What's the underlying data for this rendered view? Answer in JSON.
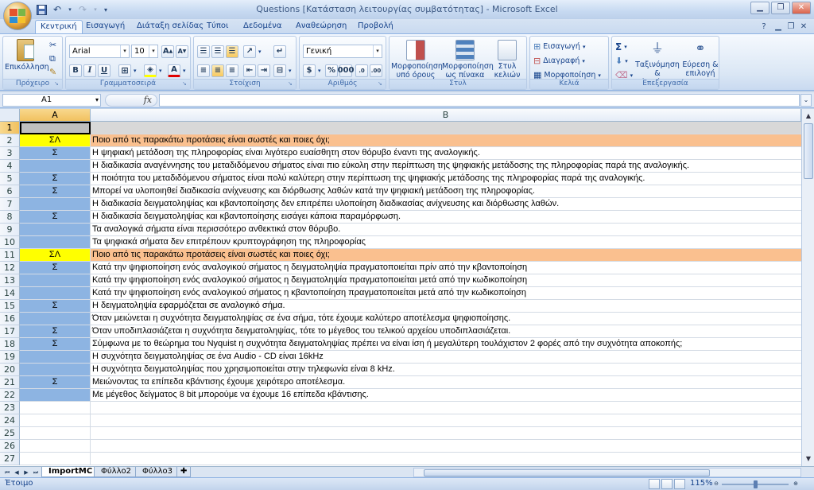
{
  "window": {
    "title": "Questions  [Κατάσταση λειτουργίας συμβατότητας] - Microsoft Excel"
  },
  "tabs": [
    "Κεντρική",
    "Εισαγωγή",
    "Διάταξη σελίδας",
    "Τύποι",
    "Δεδομένα",
    "Αναθεώρηση",
    "Προβολή"
  ],
  "ribbon": {
    "clipboard": {
      "paste": "Επικόλληση",
      "label": "Πρόχειρο"
    },
    "font": {
      "name": "Arial",
      "size": "10",
      "label": "Γραμματοσειρά"
    },
    "alignment": {
      "label": "Στοίχιση"
    },
    "number": {
      "format": "Γενική",
      "label": "Αριθμός"
    },
    "styles": {
      "conditional": "Μορφοποίηση\nυπό όρους",
      "as_table": "Μορφοποίηση\nως πίνακα",
      "cell_styles": "Στυλ\nκελιών",
      "label": "Στυλ"
    },
    "cells": {
      "insert": "Εισαγωγή",
      "delete": "Διαγραφή",
      "format": "Μορφοποίηση",
      "label": "Κελιά"
    },
    "editing": {
      "sort": "Ταξινόμηση &\nφιλτράρισμα",
      "find": "Εύρεση &\nεπιλογή",
      "label": "Επεξεργασία"
    }
  },
  "formula_bar": {
    "name_box": "A1",
    "fx": "fx",
    "value": ""
  },
  "columns": [
    "A",
    "B"
  ],
  "rows": [
    {
      "n": "1",
      "a": "",
      "b": "",
      "type": "gray"
    },
    {
      "n": "2",
      "a": "ΣΛ",
      "b": "Ποιο από τις παρακάτω προτάσεις είναι σωστές και ποιες όχι;",
      "type": "q"
    },
    {
      "n": "3",
      "a": "Σ",
      "b": "Η ψηφιακή μετάδοση της πληροφορίας είναι λιγότερο ευαίσθητη στον θόρυβο έναντι της αναλογικής.",
      "type": "ans"
    },
    {
      "n": "4",
      "a": "",
      "b": "Η διαδικασία αναγέννησης του μεταδιδόμενου σήματος είναι πιο εύκολη στην περίπτωση της ψηφιακής μετάδοσης της πληροφορίας παρά της αναλογικής.",
      "type": "ans"
    },
    {
      "n": "5",
      "a": "Σ",
      "b": "Η ποιότητα του μεταδιδόμενου σήματος είναι πολύ καλύτερη στην περίπτωση της ψηφιακής μετάδοσης της πληροφορίας παρά της αναλογικής.",
      "type": "ans"
    },
    {
      "n": "6",
      "a": "Σ",
      "b": "Μπορεί να υλοποιηθεί διαδικασία ανίχνευσης και διόρθωσης λαθών κατά την ψηφιακή μετάδοση της πληροφορίας.",
      "type": "ans"
    },
    {
      "n": "7",
      "a": "",
      "b": "Η διαδικασία δειγματοληψίας και κβαντοποίησης δεν επιτρέπει υλοποίηση διαδικασίας ανίχνευσης και διόρθωσης λαθών.",
      "type": "ans"
    },
    {
      "n": "8",
      "a": "Σ",
      "b": "Η διαδικασία δειγματοληψίας και κβαντοποίησης εισάγει κάποια παραμόρφωση.",
      "type": "ans"
    },
    {
      "n": "9",
      "a": "",
      "b": "Τα αναλογικά σήματα είναι περισσότερο ανθεκτικά στον θόρυβο.",
      "type": "ans"
    },
    {
      "n": "10",
      "a": "",
      "b": "Τα ψηφιακά σήματα δεν επιτρέπουν κρυπτογράφηση της πληροφορίας",
      "type": "ans"
    },
    {
      "n": "11",
      "a": "ΣΛ",
      "b": "Ποιο από τις παρακάτω προτάσεις είναι σωστές και ποιες όχι;",
      "type": "q"
    },
    {
      "n": "12",
      "a": "Σ",
      "b": "Κατά την ψηφιοποίηση ενός αναλογικού σήματος η δειγματοληψία πραγματοποιείται πρίν από την κβαντοποίηση",
      "type": "ans"
    },
    {
      "n": "13",
      "a": "",
      "b": "Κατά την ψηφιοποίηση ενός αναλογικού σήματος η δειγματοληψία πραγματοποιείται μετά από την κωδικοποίηση",
      "type": "ans"
    },
    {
      "n": "14",
      "a": "",
      "b": "Κατά την ψηφιοποίηση ενός αναλογικού σήματος η κβαντοποίηση πραγματοποιείται μετά από την κωδικοποίηση",
      "type": "ans"
    },
    {
      "n": "15",
      "a": "Σ",
      "b": "Η δειγματοληψία εφαρμόζεται σε αναλογικό σήμα.",
      "type": "ans"
    },
    {
      "n": "16",
      "a": "",
      "b": "Όταν μειώνεται η συχνότητα δειγματοληψίας σε ένα σήμα, τότε έχουμε καλύτερο αποτέλεσμα ψηφιοποίησης.",
      "type": "ans"
    },
    {
      "n": "17",
      "a": "Σ",
      "b": "Όταν υποδιπλασιάζεται η συχνότητα δειγματοληψίας, τότε το μέγεθος του τελικού αρχείου υποδιπλασιάζεται.",
      "type": "ans"
    },
    {
      "n": "18",
      "a": "Σ",
      "b": "Σύμφωνα με το θεώρημα του Nyquist η συχνότητα δειγματοληψίας πρέπει να είναι ίση ή μεγαλύτερη τουλάχιστον 2 φορές από την συχνότητα αποκοπής;",
      "type": "ans"
    },
    {
      "n": "19",
      "a": "",
      "b": "Η συχνότητα δειγματοληψίας σε ένα Audio - CD είναι 16kHz",
      "type": "ans"
    },
    {
      "n": "20",
      "a": "",
      "b": "Η συχνότητα δειγματοληψίας που χρησιμοποιείται στην τηλεφωνία είναι 8 kHz.",
      "type": "ans"
    },
    {
      "n": "21",
      "a": "Σ",
      "b": "Μειώνοντας τα επίπεδα κβάντισης έχουμε χειρότερο αποτέλεσμα.",
      "type": "ans"
    },
    {
      "n": "22",
      "a": "",
      "b": "Με μέγεθος δείγματος 8 bit μπορούμε να έχουμε 16 επίπεδα κβάντισης.",
      "type": "ans"
    },
    {
      "n": "23",
      "a": "",
      "b": "",
      "type": "empty"
    },
    {
      "n": "24",
      "a": "",
      "b": "",
      "type": "empty"
    },
    {
      "n": "25",
      "a": "",
      "b": "",
      "type": "empty"
    },
    {
      "n": "26",
      "a": "",
      "b": "",
      "type": "empty"
    },
    {
      "n": "27",
      "a": "",
      "b": "",
      "type": "empty"
    }
  ],
  "sheets": [
    "ImportMC",
    "Φύλλο2",
    "Φύλλο3"
  ],
  "status": {
    "text": "Έτοιμο",
    "zoom": "115%",
    "zoom_level": 0.5
  },
  "colors": {
    "question_bg": "#fac08f",
    "question_a_bg": "#ffff00",
    "answer_a_bg": "#8db4e2",
    "gray_row": "#d8d8d8"
  }
}
